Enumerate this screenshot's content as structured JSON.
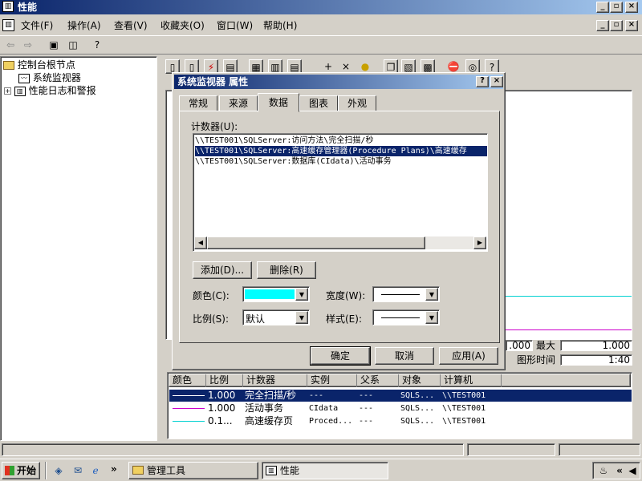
{
  "app": {
    "title": "性能"
  },
  "menu": [
    "文件(F)",
    "操作(A)",
    "查看(V)",
    "收藏夹(O)",
    "窗口(W)",
    "帮助(H)"
  ],
  "tree": {
    "root": "控制台根节点",
    "items": [
      "系统监视器",
      "性能日志和警报"
    ]
  },
  "dialog": {
    "title": "系统监视器 属性",
    "help": "?",
    "close": "×",
    "tabs": [
      "常规",
      "来源",
      "数据",
      "图表",
      "外观"
    ],
    "counters_label": "计数器(U):",
    "counters": [
      "\\\\TEST001\\SQLServer:访问方法\\完全扫描/秒",
      "\\\\TEST001\\SQLServer:高速缓存管理器(Procedure Plans)\\高速缓存",
      "\\\\TEST001\\SQLServer:数据库(CIdata)\\活动事务"
    ],
    "add": "添加(D)...",
    "remove": "删除(R)",
    "color_label": "颜色(C):",
    "width_label": "宽度(W):",
    "scale_label": "比例(S):",
    "scale_value": "默认",
    "style_label": "样式(E):",
    "ok": "确定",
    "cancel": "取消",
    "apply": "应用(A)"
  },
  "stats": {
    "max_label": "最大",
    "max_value": "1.000",
    "min_value": ".000",
    "duration_label": "图形时间",
    "duration_value": "1:40"
  },
  "legend": {
    "headers": [
      "颜色",
      "比例",
      "计数器",
      "实例",
      "父系",
      "对象",
      "计算机"
    ],
    "rows": [
      {
        "scale": "1.000",
        "counter": "完全扫描/秒",
        "instance": "---",
        "parent": "---",
        "object": "SQLS...",
        "computer": "\\\\TEST001",
        "color": "#ffffff"
      },
      {
        "scale": "1.000",
        "counter": "活动事务",
        "instance": "CIdata",
        "parent": "---",
        "object": "SQLS...",
        "computer": "\\\\TEST001",
        "color": "#cc00cc"
      },
      {
        "scale": "0.1...",
        "counter": "高速缓存页",
        "instance": "Proced...",
        "parent": "---",
        "object": "SQLS...",
        "computer": "\\\\TEST001",
        "color": "#00d0d0"
      }
    ]
  },
  "taskbar": {
    "start": "开始",
    "tasks": [
      "管理工具",
      "性能"
    ],
    "chev": "»"
  },
  "colors": {
    "accent": "#0a246a",
    "counter_color": "#00ffff",
    "series_magenta": "#cc00cc"
  }
}
